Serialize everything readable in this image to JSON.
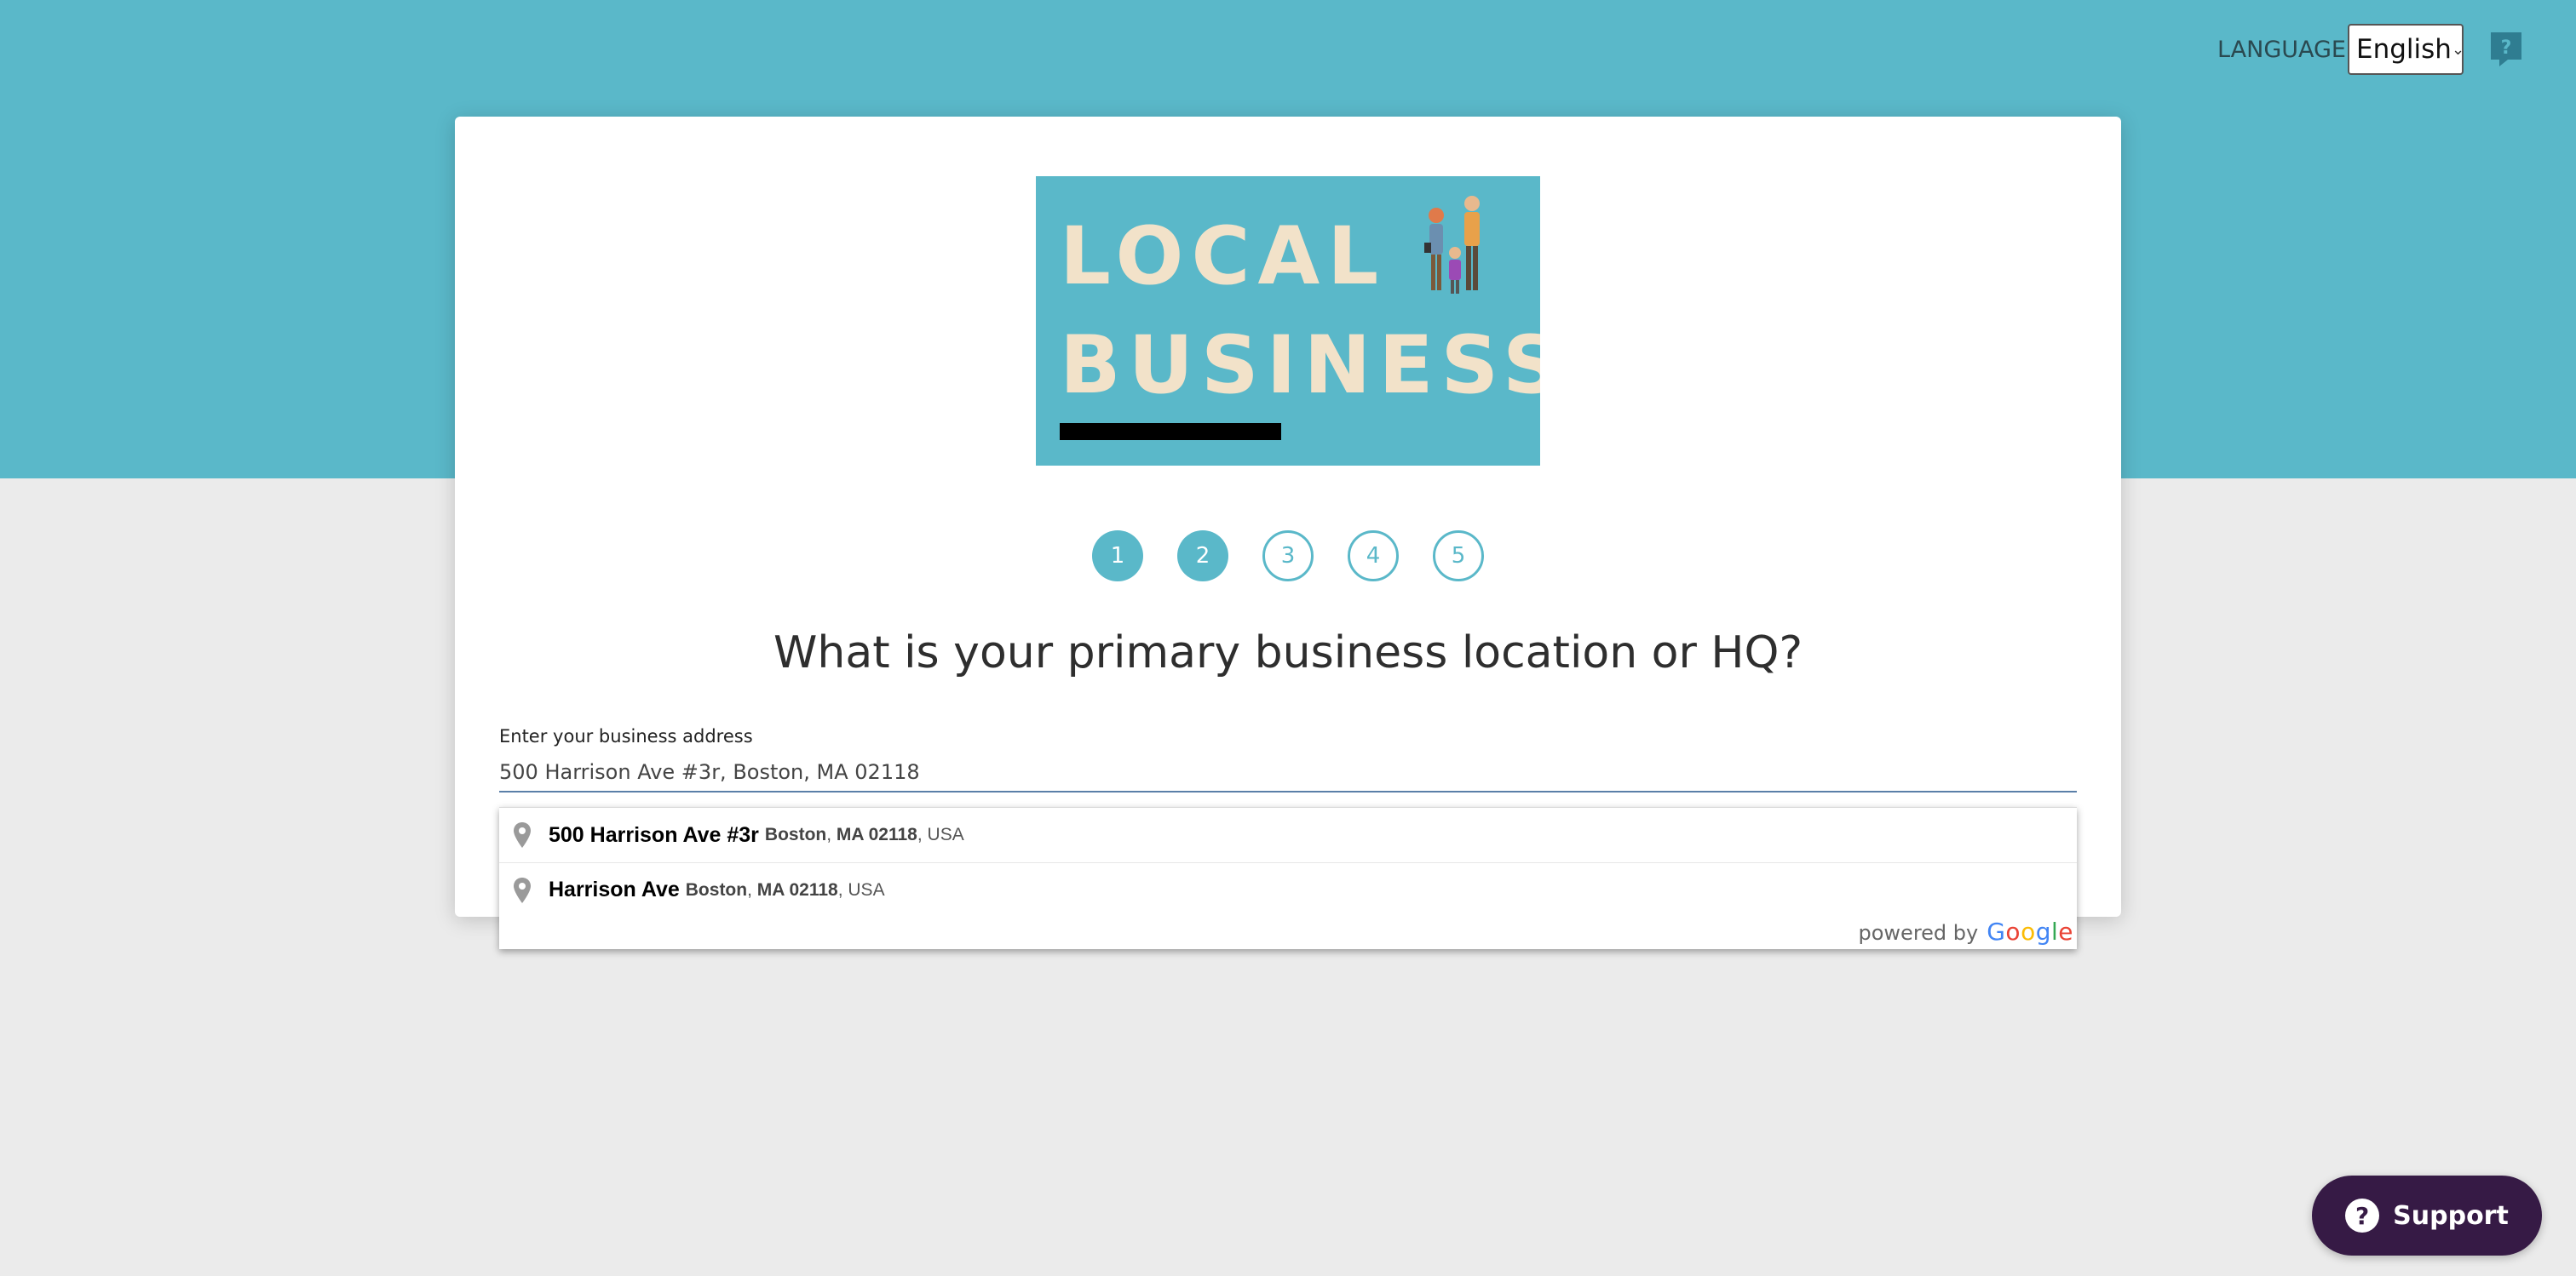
{
  "header": {
    "language_label": "LANGUAGE",
    "language_value": "English",
    "help_icon": "help-question-icon"
  },
  "logo": {
    "line1": "LOCAL",
    "line2": "BUSINESS"
  },
  "steps": {
    "current": 2,
    "total": 5,
    "items": [
      "1",
      "2",
      "3",
      "4",
      "5"
    ]
  },
  "question": "What is your primary business location or HQ?",
  "address_field": {
    "label": "Enter your business address",
    "value": "500 Harrison Ave #3r, Boston, MA 02118"
  },
  "suggestions": [
    {
      "main": "500 Harrison Ave #3r",
      "city": "Boston",
      "state_zip": "MA 02118",
      "country": "USA"
    },
    {
      "main": "Harrison Ave",
      "city": "Boston",
      "state_zip": "MA 02118",
      "country": "USA"
    }
  ],
  "attribution": {
    "powered_by": "powered by",
    "google_letters": [
      "G",
      "o",
      "o",
      "g",
      "l",
      "e"
    ]
  },
  "support_button": {
    "label": "Support",
    "icon_glyph": "?"
  },
  "colors": {
    "brand_teal": "#5ab8c9",
    "support_purple": "#361a45",
    "logo_text": "#f2e2c9"
  }
}
